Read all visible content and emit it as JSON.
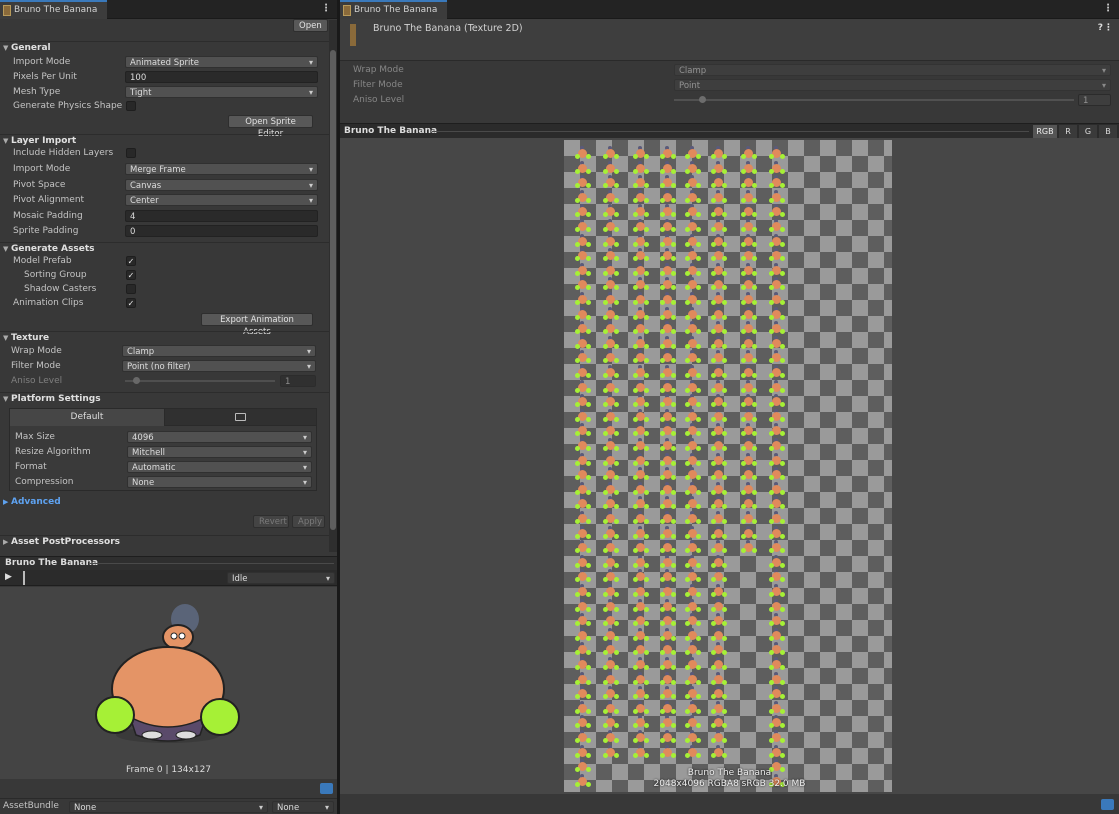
{
  "left_tab": {
    "title": "Bruno The Banana",
    "open_label": "Open"
  },
  "general": {
    "header": "General",
    "import_mode_label": "Import Mode",
    "import_mode": "Animated Sprite",
    "ppu_label": "Pixels Per Unit",
    "ppu": "100",
    "mesh_type_label": "Mesh Type",
    "mesh_type": "Tight",
    "physics_label": "Generate Physics Shape",
    "sprite_editor_button": "Open Sprite Editor"
  },
  "layer_import": {
    "header": "Layer Import",
    "hidden_label": "Include Hidden Layers",
    "import_mode_label": "Import Mode",
    "import_mode": "Merge Frame",
    "pivot_space_label": "Pivot Space",
    "pivot_space": "Canvas",
    "pivot_align_label": "Pivot Alignment",
    "pivot_align": "Center",
    "mosaic_label": "Mosaic Padding",
    "mosaic": "4",
    "sprite_pad_label": "Sprite Padding",
    "sprite_pad": "0"
  },
  "gen_assets": {
    "header": "Generate Assets",
    "model_prefab_label": "Model Prefab",
    "model_prefab": true,
    "sorting_group_label": "Sorting Group",
    "sorting_group": true,
    "shadow_label": "Shadow Casters",
    "shadow": false,
    "anim_clips_label": "Animation Clips",
    "anim_clips": true,
    "export_button": "Export Animation Assets"
  },
  "texture": {
    "header": "Texture",
    "wrap_label": "Wrap Mode",
    "wrap": "Clamp",
    "filter_label": "Filter Mode",
    "filter": "Point (no filter)",
    "aniso_label": "Aniso Level",
    "aniso": "1"
  },
  "platform": {
    "header": "Platform Settings",
    "default_tab": "Default",
    "max_size_label": "Max Size",
    "max_size": "4096",
    "resize_label": "Resize Algorithm",
    "resize": "Mitchell",
    "format_label": "Format",
    "format": "Automatic",
    "compression_label": "Compression",
    "compression": "None"
  },
  "advanced": {
    "header": "Advanced"
  },
  "revert_label": "Revert",
  "apply_label": "Apply",
  "postprocessors": {
    "header": "Asset PostProcessors"
  },
  "preview": {
    "title": "Bruno The Banana",
    "clip": "Idle",
    "frame_info": "Frame 0 | 134x127"
  },
  "asset_bundle": {
    "label": "AssetBundle",
    "name": "None",
    "variant": "None"
  },
  "right_tab": {
    "title": "Bruno The Banana"
  },
  "texture_header": {
    "title": "Bruno The Banana (Texture 2D)"
  },
  "tex_settings": {
    "wrap_label": "Wrap Mode",
    "wrap": "Clamp",
    "filter_label": "Filter Mode",
    "filter": "Point",
    "aniso_label": "Aniso Level",
    "aniso": "1"
  },
  "tex_preview": {
    "title": "Bruno The Banana",
    "channels": [
      "RGB",
      "R",
      "G",
      "B"
    ],
    "caption_name": "Bruno The Banana",
    "caption_info": "2048x4096 RGBA8 sRGB  32.0 MB"
  },
  "colors": {
    "accent": "#3a79bb",
    "glove": "#a6f036",
    "skin": "#e08a5c",
    "link": "#5ea2f0"
  }
}
